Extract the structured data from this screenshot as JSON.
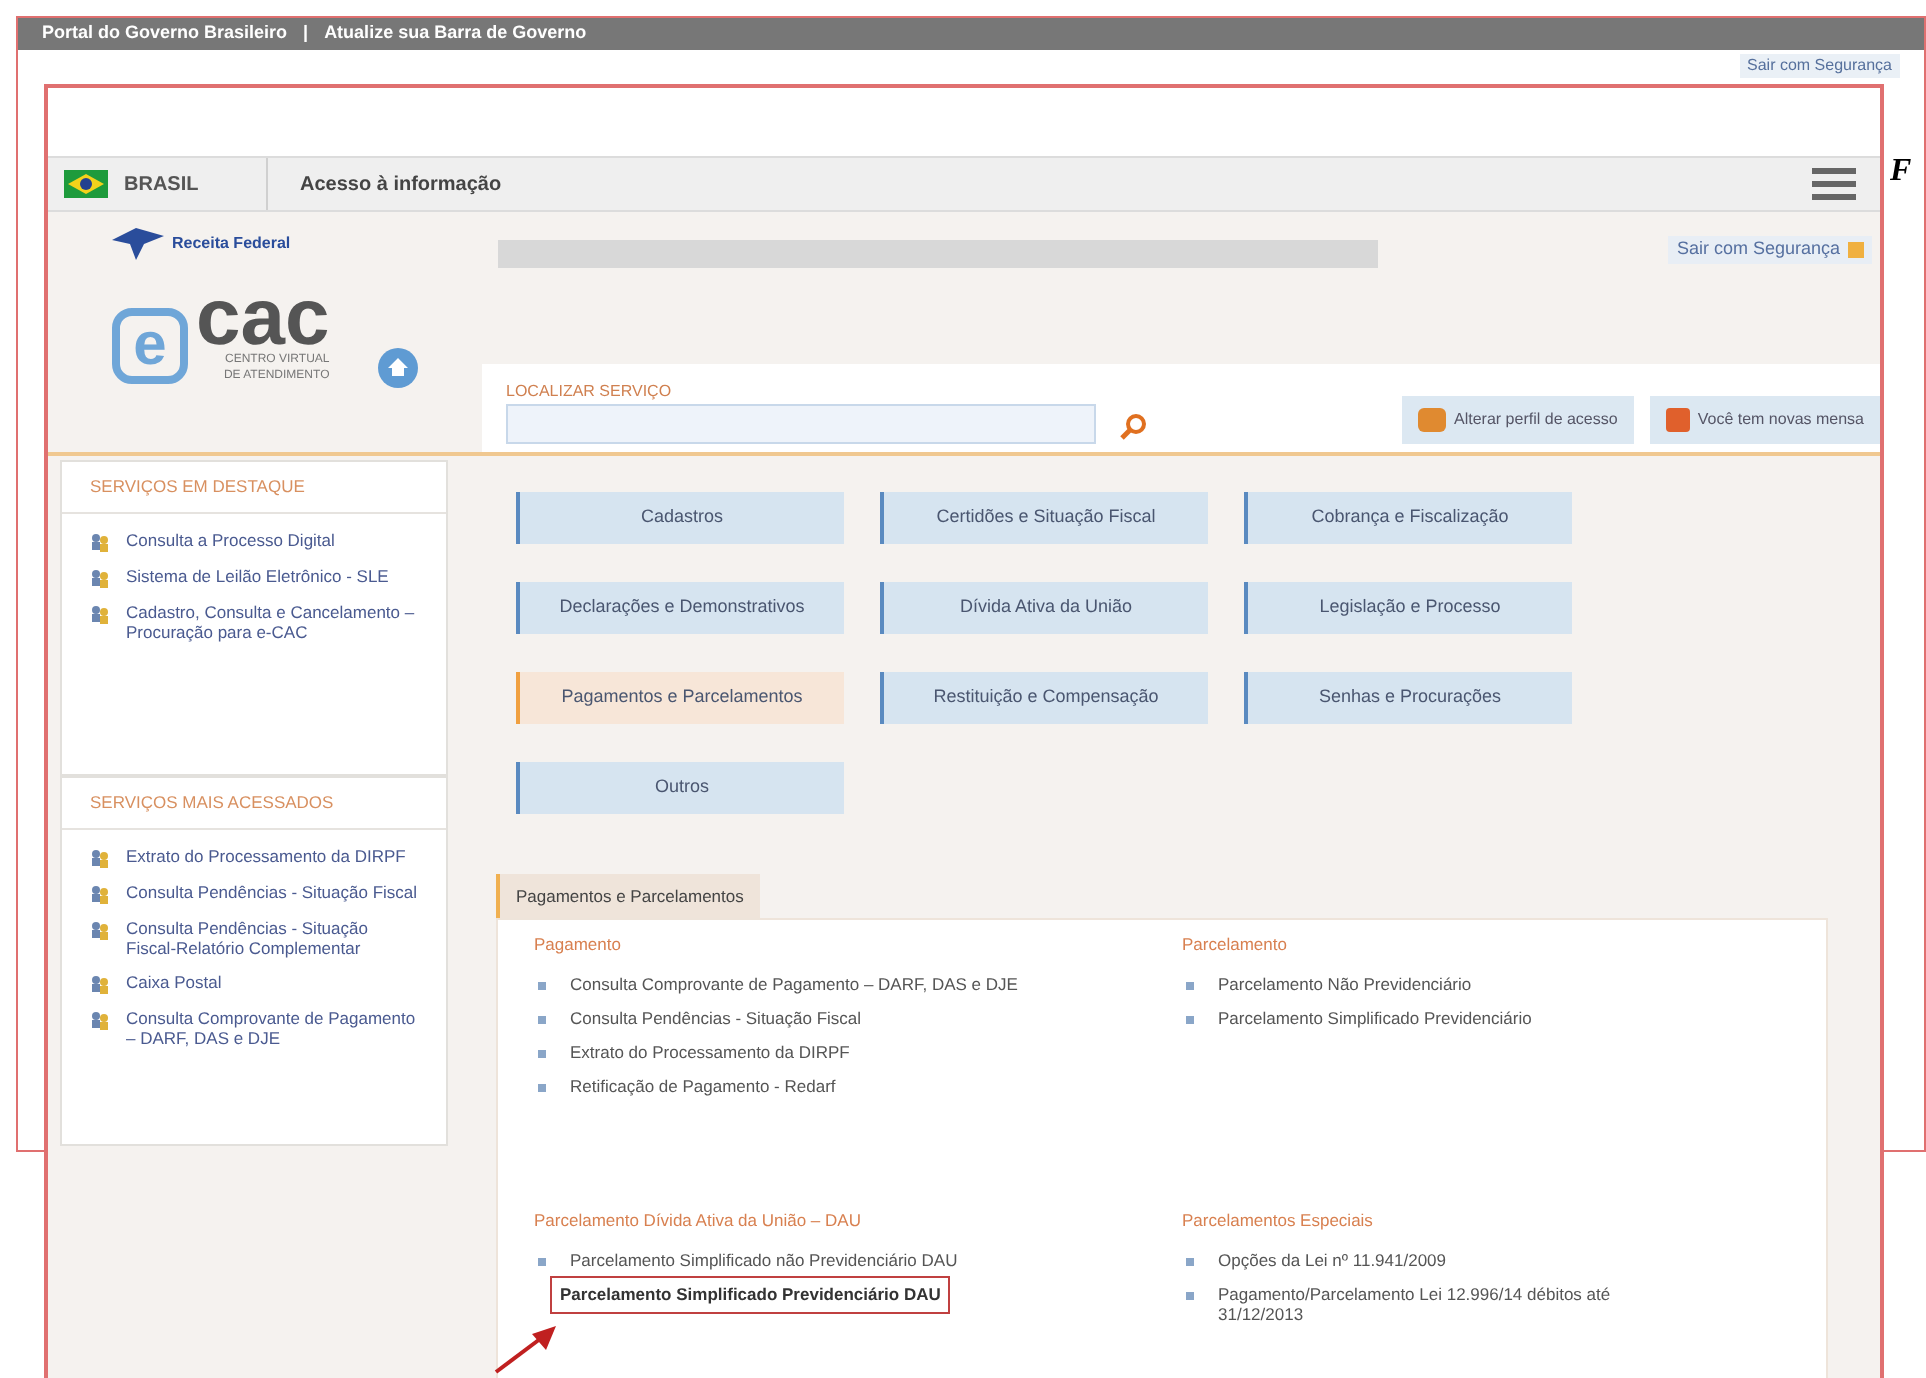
{
  "background_page": {
    "gov_bar": [
      "Portal do Governo Brasileiro",
      "|",
      "Atualize sua Barra de Governo"
    ],
    "logout_link": "Sair com Segurança"
  },
  "annotation_letter": "F",
  "gov_bar": {
    "country": "BRASIL",
    "link": "Acesso à informação"
  },
  "header": {
    "agency": "Receita Federal",
    "logo_letter": "e",
    "logo_text": "cac",
    "logo_subtitle": [
      "CENTRO VIRTUAL",
      "DE ATENDIMENTO"
    ],
    "logout_link": "Sair com Segurança",
    "search": {
      "label": "LOCALIZAR SERVIÇO"
    },
    "actions": [
      "Alterar perfil de acesso",
      "Você tem novas mensa"
    ]
  },
  "sidebar": [
    {
      "title": "SERVIÇOS EM DESTAQUE",
      "items": [
        "Consulta a Processo Digital",
        "Sistema de Leilão Eletrônico - SLE",
        "Cadastro, Consulta e Cancelamento – Procuração para e-CAC"
      ]
    },
    {
      "title": "SERVIÇOS MAIS ACESSADOS",
      "items": [
        "Extrato do Processamento da DIRPF",
        "Consulta Pendências - Situação Fiscal",
        "Consulta Pendências - Situação Fiscal-Relatório Complementar",
        "Caixa Postal",
        "Consulta Comprovante de Pagamento – DARF, DAS e DJE"
      ]
    }
  ],
  "categories": [
    {
      "label": "Cadastros",
      "selected": false
    },
    {
      "label": "Certidões e Situação Fiscal",
      "selected": false
    },
    {
      "label": "Cobrança e Fiscalização",
      "selected": false
    },
    {
      "label": "Declarações e Demonstrativos",
      "selected": false
    },
    {
      "label": "Dívida Ativa da União",
      "selected": false
    },
    {
      "label": "Legislação e Processo",
      "selected": false
    },
    {
      "label": "Pagamentos e Parcelamentos",
      "selected": true
    },
    {
      "label": "Restituição e Compensação",
      "selected": false
    },
    {
      "label": "Senhas e Procurações",
      "selected": false
    },
    {
      "label": "Outros",
      "selected": false
    }
  ],
  "tabs": [
    {
      "label": "Pagamentos e Parcelamentos",
      "selected": true
    }
  ],
  "columns": [
    [
      {
        "title": "Pagamento",
        "items": [
          {
            "label": "Consulta Comprovante de Pagamento – DARF, DAS e DJE",
            "highlighted": false
          },
          {
            "label": "Consulta Pendências - Situação Fiscal",
            "highlighted": false
          },
          {
            "label": "Extrato do Processamento da DIRPF",
            "highlighted": false
          },
          {
            "label": "Retificação de Pagamento - Redarf",
            "highlighted": false
          }
        ]
      },
      {
        "title": "Parcelamento Dívida Ativa da União – DAU",
        "items": [
          {
            "label": "Parcelamento Simplificado não Previdenciário DAU",
            "highlighted": false
          },
          {
            "label": "Parcelamento Simplificado Previdenciário DAU",
            "highlighted": true
          }
        ]
      }
    ],
    [
      {
        "title": "Parcelamento",
        "items": [
          {
            "label": "Parcelamento Não Previdenciário",
            "highlighted": false
          },
          {
            "label": "Parcelamento Simplificado Previdenciário",
            "highlighted": false
          }
        ]
      },
      {
        "title": "Parcelamentos Especiais",
        "items": [
          {
            "label": "Opções da Lei nº 11.941/2009",
            "highlighted": false
          },
          {
            "label": "Pagamento/Parcelamento Lei 12.996/14 débitos até 31/12/2013",
            "highlighted": false
          }
        ]
      }
    ]
  ]
}
